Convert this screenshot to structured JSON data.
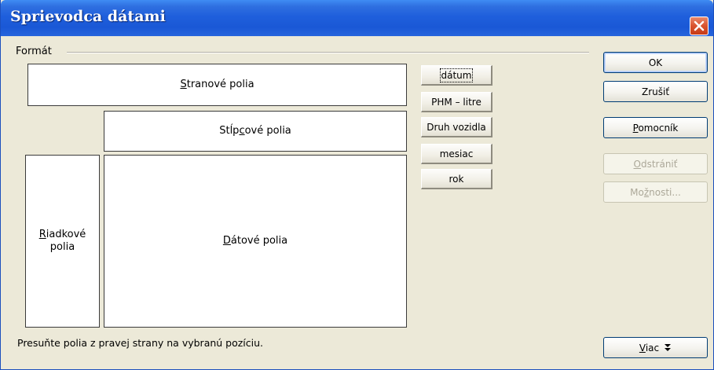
{
  "window": {
    "title": "Sprievodca dátami",
    "close_icon": "close-icon"
  },
  "format_group": {
    "label": "Formát"
  },
  "areas": {
    "page_fields": {
      "pre": "",
      "ul": "S",
      "post": "tranové polia"
    },
    "column_fields": {
      "pre": "Stĺp",
      "ul": "c",
      "post": "ové polia"
    },
    "row_fields": {
      "pre": "",
      "ul": "R",
      "post": "iadkové",
      "line2": "polia"
    },
    "data_fields": {
      "pre": "",
      "ul": "D",
      "post": "átové polia"
    }
  },
  "fields": [
    {
      "label": "dátum",
      "selected": true
    },
    {
      "label": "PHM – litre",
      "selected": false
    },
    {
      "label": "Druh vozidla",
      "selected": false
    },
    {
      "label": "mesiac",
      "selected": false
    },
    {
      "label": "rok",
      "selected": false
    }
  ],
  "buttons": {
    "ok": "OK",
    "cancel": "Zrušiť",
    "help": {
      "pre": "",
      "ul": "P",
      "post": "omocník"
    },
    "remove": {
      "pre": "",
      "ul": "O",
      "post": "dstrániť"
    },
    "options": {
      "pre": "Mo",
      "ul": "ž",
      "post": "nosti..."
    },
    "more": {
      "pre": "",
      "ul": "V",
      "post": "iac",
      "icon": "double-chevron-down-icon"
    }
  },
  "hint": "Presuňte polia z pravej strany na vybranú pozíciu."
}
